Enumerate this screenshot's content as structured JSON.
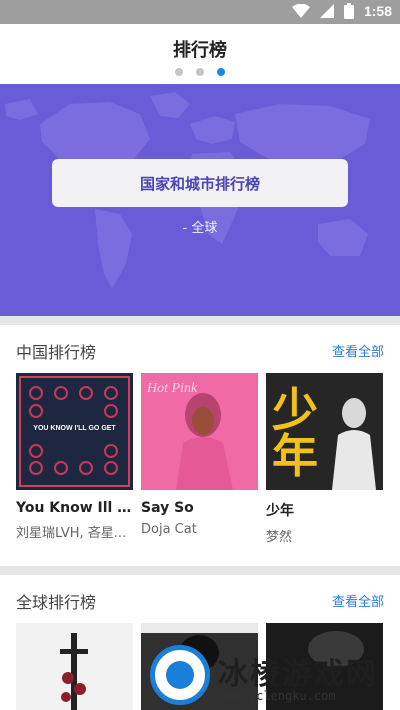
{
  "status_bar": {
    "time": "1:58"
  },
  "header": {
    "title": "排行榜",
    "page_indicator": {
      "count": 3,
      "active": 3
    }
  },
  "banner": {
    "button_label": "国家和城市排行榜",
    "subtitle": "- 全球"
  },
  "china_chart": {
    "title": "中国排行榜",
    "see_all": "查看全部",
    "items": [
      {
        "name": "You Know Ill G...",
        "artist": "刘星瑞LVH, 吝星...",
        "cover_text": "YOU KNOW I'LL GO GET"
      },
      {
        "name": "Say So",
        "artist": "Doja Cat",
        "cover_text": "Hot Pink"
      },
      {
        "name": "少年",
        "artist": "梦然",
        "cover_text": "少年"
      }
    ]
  },
  "global_chart": {
    "title": "全球排行榜",
    "see_all": "查看全部"
  },
  "watermark": {
    "text": "冰棱游戏网",
    "url": "www.yclengku.com"
  }
}
